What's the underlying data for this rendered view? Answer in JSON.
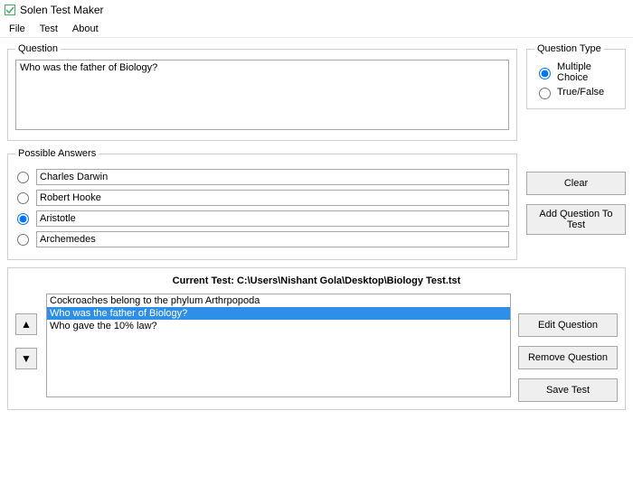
{
  "window": {
    "title": "Solen Test Maker"
  },
  "menu": {
    "file": "File",
    "test": "Test",
    "about": "About"
  },
  "question_group": {
    "legend": "Question",
    "text": "Who was the father of Biology?"
  },
  "question_type": {
    "legend": "Question Type",
    "options": {
      "multiple": "Multiple Choice",
      "truefalse": "True/False"
    },
    "selected": "multiple"
  },
  "answers": {
    "legend": "Possible Answers",
    "items": [
      "Charles Darwin",
      "Robert Hooke",
      "Aristotle",
      "Archemedes"
    ],
    "selected_index": 2
  },
  "buttons": {
    "clear": "Clear",
    "add_question": "Add Question To Test",
    "edit_question": "Edit Question",
    "remove_question": "Remove Question",
    "save_test": "Save Test"
  },
  "current_test": {
    "label_prefix": "Current Test: ",
    "path": "C:\\Users\\Nishant Gola\\Desktop\\Biology Test.tst",
    "items": [
      "Cockroaches belong to the phylum Arthrpopoda",
      "Who was the father of Biology?",
      "Who gave the 10% law?"
    ],
    "selected_index": 1
  }
}
